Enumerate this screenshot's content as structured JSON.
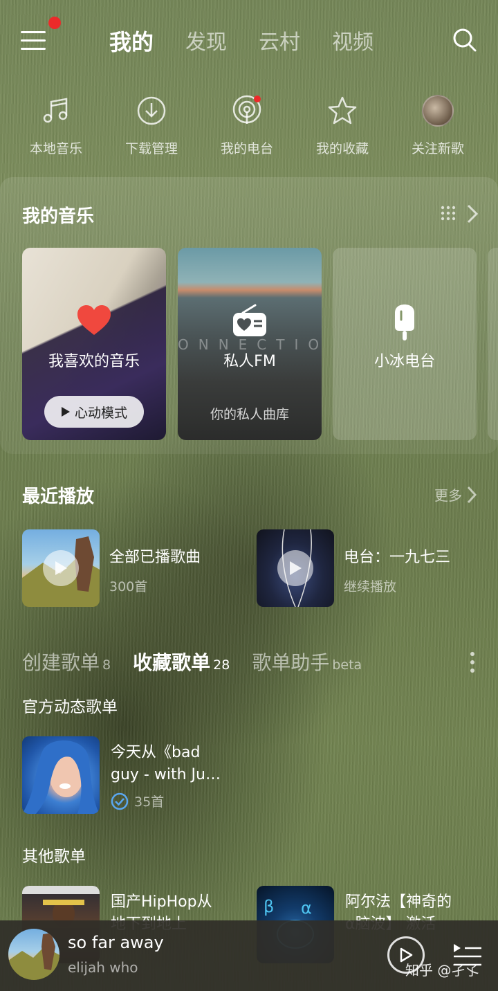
{
  "header": {
    "tabs": [
      "我的",
      "发现",
      "云村",
      "视频"
    ],
    "active_tab": "我的"
  },
  "shortcuts": [
    {
      "label": "本地音乐",
      "icon": "music-note-icon"
    },
    {
      "label": "下载管理",
      "icon": "download-icon"
    },
    {
      "label": "我的电台",
      "icon": "podcast-icon"
    },
    {
      "label": "我的收藏",
      "icon": "star-icon"
    },
    {
      "label": "关注新歌",
      "icon": "avatar"
    }
  ],
  "my_music": {
    "title": "我的音乐",
    "cards": [
      {
        "title": "我喜欢的音乐",
        "button": "心动模式",
        "icon": "heart-icon"
      },
      {
        "title": "私人FM",
        "subtitle": "你的私人曲库",
        "icon": "radio-icon",
        "overlay": "ONNECTIO"
      },
      {
        "title": "小冰电台",
        "icon": "popsicle-icon"
      }
    ]
  },
  "recent": {
    "title": "最近播放",
    "more_label": "更多",
    "items": [
      {
        "title": "全部已播歌曲",
        "subtitle": "300首"
      },
      {
        "title": "电台：一九七三",
        "subtitle": "继续播放"
      }
    ]
  },
  "playlist_tabs": [
    {
      "label": "创建歌单",
      "count": "8"
    },
    {
      "label": "收藏歌单",
      "count": "28"
    },
    {
      "label": "歌单助手",
      "count": "beta"
    }
  ],
  "official": {
    "heading": "官方动态歌单",
    "items": [
      {
        "title": "今天从《bad guy - with Ju…",
        "title_line1": "今天从《bad",
        "title_line2": "guy - with Ju…",
        "count": "35首"
      }
    ]
  },
  "other": {
    "heading": "其他歌单",
    "items": [
      {
        "title_line1": "国产HipHop从",
        "title_line2": "地下到地上"
      },
      {
        "title_line1": "阿尔法【神奇的",
        "title_line2": "α脑波】 激活"
      }
    ]
  },
  "player": {
    "title": "so far away",
    "artist": "elijah who"
  },
  "watermark": "知乎 @孑孓",
  "colors": {
    "accent_red": "#ec2a2a",
    "heart_red": "#f0483e",
    "player_bar": "#302e28"
  }
}
